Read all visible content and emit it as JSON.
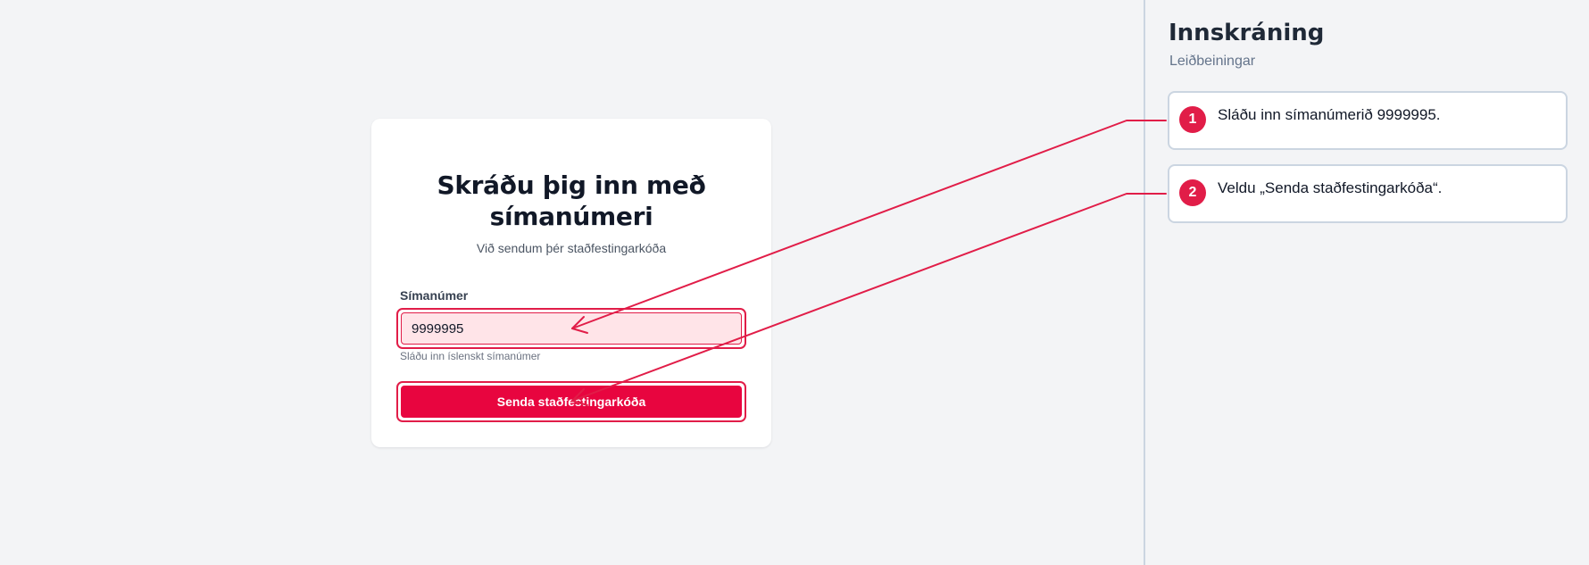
{
  "login": {
    "title": "Skráðu þig inn með símanúmeri",
    "subtitle": "Við sendum þér staðfestingarkóða",
    "phone_label": "Símanúmer",
    "phone_value": "9999995",
    "phone_help": "Sláðu inn íslenskt símanúmer",
    "submit_label": "Senda staðfestingarkóða"
  },
  "panel": {
    "title": "Innskráning",
    "subtitle": "Leiðbeiningar",
    "steps": [
      {
        "number": "1",
        "text": "Sláðu inn símanúmerið 9999995."
      },
      {
        "number": "2",
        "text": "Veldu „Senda staðfestingarkóða“."
      }
    ]
  },
  "colors": {
    "accent": "#e11d48",
    "button": "#e8053f",
    "input_highlight_bg": "#ffe4e8",
    "page_bg": "#f3f4f6"
  }
}
